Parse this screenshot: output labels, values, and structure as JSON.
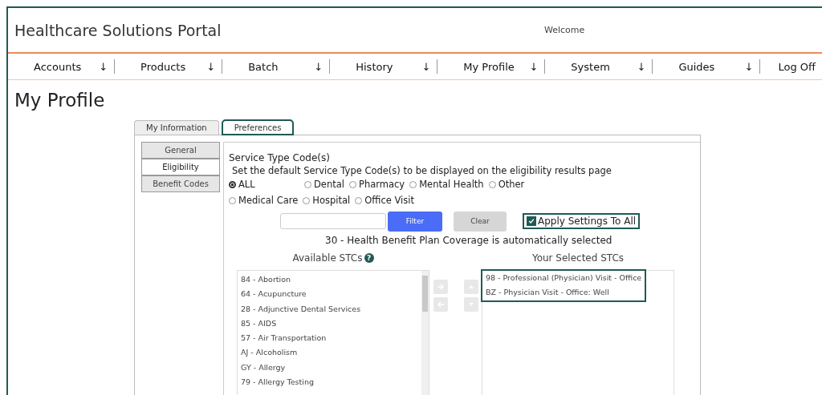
{
  "header": {
    "title": "Healthcare Solutions Portal",
    "welcome": "Welcome"
  },
  "nav": [
    {
      "label": "Accounts",
      "arrow": "↓"
    },
    {
      "label": "Products",
      "arrow": "↓"
    },
    {
      "label": "Batch",
      "arrow": "↓"
    },
    {
      "label": "History",
      "arrow": "↓"
    },
    {
      "label": "My Profile",
      "arrow": "↓"
    },
    {
      "label": "System",
      "arrow": "↓"
    },
    {
      "label": "Guides",
      "arrow": "↓"
    },
    {
      "label": "Log Off"
    }
  ],
  "page_title": "My Profile",
  "tabs": [
    {
      "label": "My Information",
      "selected": false,
      "highlighted": false
    },
    {
      "label": "Preferences",
      "selected": true,
      "highlighted": true
    }
  ],
  "side_tabs": [
    {
      "label": "General",
      "selected": false
    },
    {
      "label": "Eligibility",
      "selected": true
    },
    {
      "label": "Benefit Codes",
      "selected": false
    }
  ],
  "section": {
    "title": "Service Type Code(s)",
    "description": "Set the default Service Type Code(s) to be displayed on the eligibility results page"
  },
  "radio_rows": [
    [
      {
        "label": "ALL",
        "selected": true
      },
      {
        "label": "Dental",
        "selected": false
      },
      {
        "label": "Pharmacy",
        "selected": false
      },
      {
        "label": "Mental Health",
        "selected": false
      },
      {
        "label": "Other",
        "selected": false
      }
    ],
    [
      {
        "label": "Medical Care",
        "selected": false
      },
      {
        "label": "Hospital",
        "selected": false
      },
      {
        "label": "Office Visit",
        "selected": false
      }
    ]
  ],
  "filter": {
    "button": "Filter",
    "clear": "Clear"
  },
  "apply_all": {
    "label": "Apply Settings To All",
    "checked": true,
    "highlighted": true
  },
  "note": "30 - Health Benefit Plan Coverage is automatically selected",
  "available": {
    "heading": "Available STCs",
    "help": "?",
    "items": [
      "84 - Abortion",
      "64 - Acupuncture",
      "28 - Adjunctive Dental Services",
      "85 - AIDS",
      "57 - Air Transportation",
      "AJ - Alcoholism",
      "GY - Allergy",
      "79 - Allergy Testing"
    ]
  },
  "selected": {
    "heading": "Your Selected STCs",
    "highlighted": true,
    "items": [
      "98 - Professional (Physician) Visit - Office",
      "BZ - Physician Visit - Office: Well"
    ]
  }
}
